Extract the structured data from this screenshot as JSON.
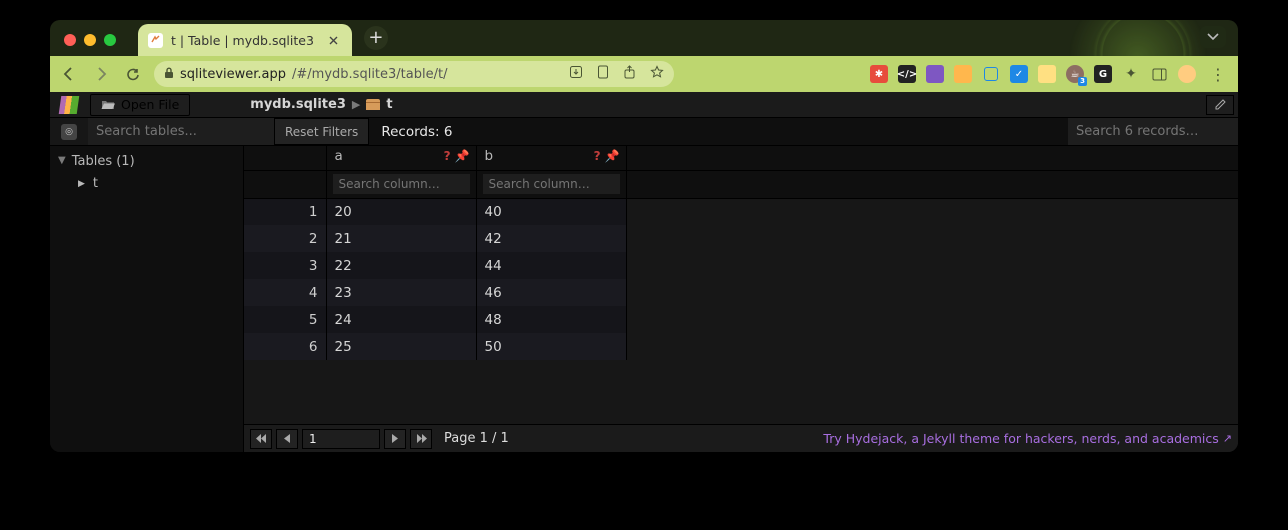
{
  "browser": {
    "tab_title": "t | Table | mydb.sqlite3",
    "url_host": "sqliteviewer.app",
    "url_path": "/#/mydb.sqlite3/table/t/"
  },
  "topbar": {
    "open_file_label": "Open File",
    "breadcrumb_db": "mydb.sqlite3",
    "breadcrumb_table": "t",
    "edit_icon": "✓"
  },
  "sidebar": {
    "search_placeholder": "Search tables...",
    "group_label": "Tables (1)",
    "items": [
      {
        "label": "t"
      }
    ]
  },
  "toolbar": {
    "reset_label": "Reset Filters",
    "records_label": "Records: 6",
    "search_records_placeholder": "Search 6 records…"
  },
  "table": {
    "columns": [
      {
        "name": "a",
        "search_placeholder": "Search column…"
      },
      {
        "name": "b",
        "search_placeholder": "Search column…"
      }
    ],
    "rows": [
      {
        "idx": "1",
        "cells": [
          "20",
          "40"
        ]
      },
      {
        "idx": "2",
        "cells": [
          "21",
          "42"
        ]
      },
      {
        "idx": "3",
        "cells": [
          "22",
          "44"
        ]
      },
      {
        "idx": "4",
        "cells": [
          "23",
          "46"
        ]
      },
      {
        "idx": "5",
        "cells": [
          "24",
          "48"
        ]
      },
      {
        "idx": "6",
        "cells": [
          "25",
          "50"
        ]
      }
    ]
  },
  "footer": {
    "page_input": "1",
    "page_label": "Page 1 / 1",
    "promo_text": "Try Hydejack, a Jekyll theme for hackers, nerds, and academics"
  }
}
